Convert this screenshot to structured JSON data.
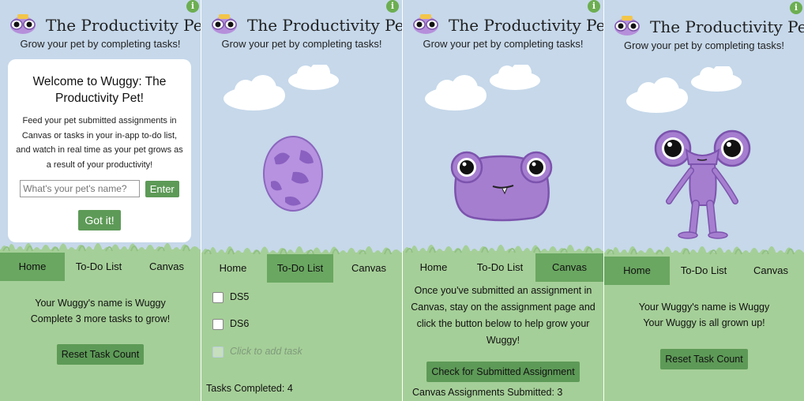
{
  "app": {
    "title": "The Productivity Pet",
    "subtitle": "Grow your pet by completing tasks!",
    "info_icon": "i"
  },
  "colors": {
    "sky": "#c6d8ea",
    "ground": "#a5cf98",
    "tab_active": "#6aa761",
    "button": "#5d9a57",
    "pet_purple": "#a67ed0"
  },
  "nav": {
    "home": "Home",
    "todo": "To-Do List",
    "canvas": "Canvas"
  },
  "welcome": {
    "heading": "Welcome to Wuggy: The Productivity Pet!",
    "body": "Feed your pet submitted assignments in Canvas or tasks in your in-app to-do list, and watch in real time as your pet grows as a result of your productivity!",
    "name_placeholder": "What's your pet's name?",
    "enter_label": "Enter",
    "gotit_label": "Got it!"
  },
  "home1": {
    "name_line": "Your Wuggy's name is Wuggy",
    "status_line": "Complete 3 more tasks to grow!",
    "reset_label": "Reset Task Count"
  },
  "todo": {
    "items": [
      "DS5",
      "DS6"
    ],
    "add_placeholder": "Click to add task",
    "completed": "Tasks Completed: 4"
  },
  "canvas": {
    "instructions": "Once you've submitted an assignment in Canvas, stay on the assignment page and click the button below to help grow your Wuggy!",
    "check_label": "Check for Submitted Assignment",
    "submitted": "Canvas Assignments Submitted: 3"
  },
  "home2": {
    "name_line": "Your Wuggy's name is Wuggy",
    "status_line": "Your Wuggy is all grown up!",
    "reset_label": "Reset Task Count"
  }
}
